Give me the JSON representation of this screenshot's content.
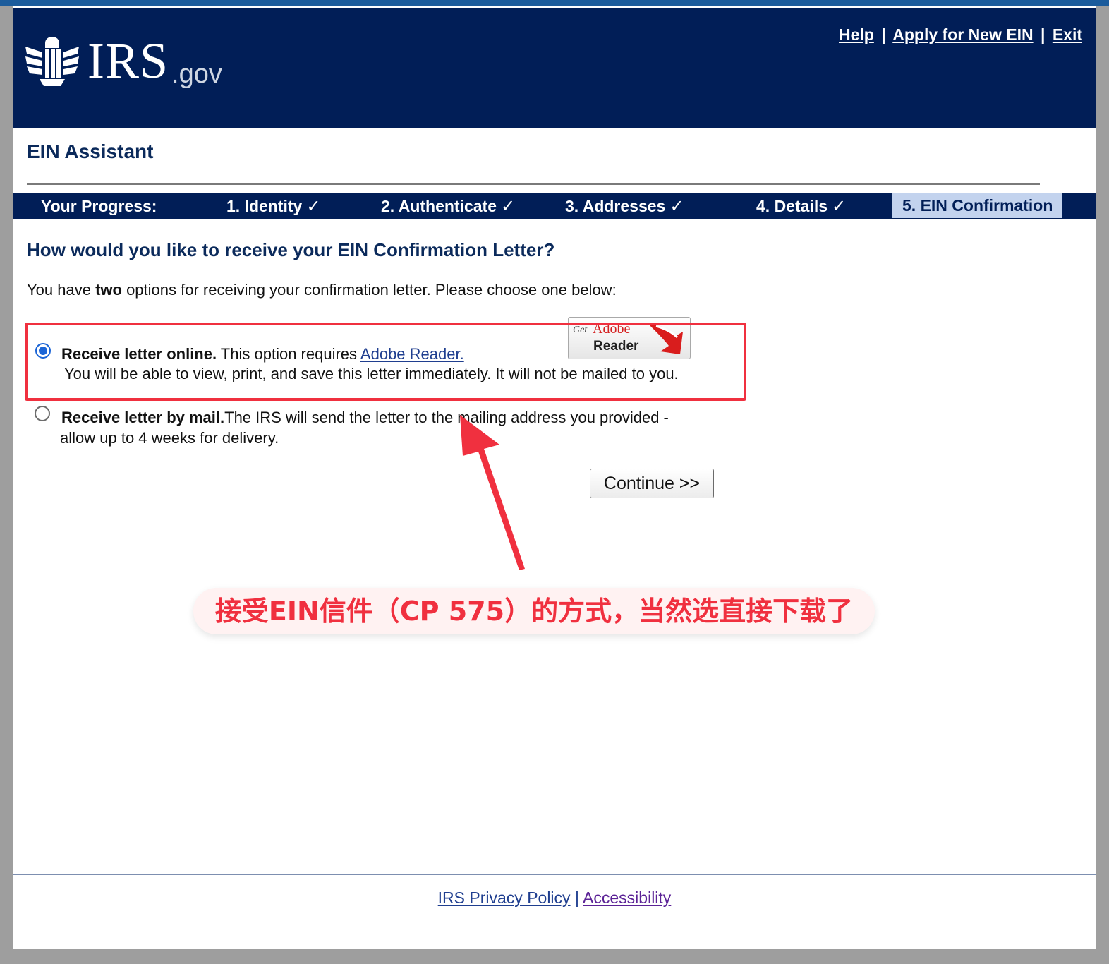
{
  "header": {
    "logo_text": "IRS",
    "logo_suffix": ".gov",
    "links": {
      "help": "Help",
      "apply": "Apply for New EIN",
      "exit": "Exit",
      "separator": "|"
    }
  },
  "app_title": "EIN Assistant",
  "progress": {
    "label": "Your Progress:",
    "check_icon": "✓",
    "steps": [
      {
        "label": "1. Identity",
        "complete": true
      },
      {
        "label": "2. Authenticate",
        "complete": true
      },
      {
        "label": "3. Addresses",
        "complete": true
      },
      {
        "label": "4. Details",
        "complete": true
      },
      {
        "label": "5. EIN Confirmation",
        "current": true
      }
    ]
  },
  "main": {
    "question": "How would you like to receive your EIN Confirmation Letter?",
    "intro_before": "You have ",
    "intro_bold": "two",
    "intro_after": " options for receiving your confirmation letter. Please choose one below:",
    "options": [
      {
        "selected": true,
        "title": "Receive letter online.",
        "text": " This option requires ",
        "link": "Adobe Reader.",
        "line2": "You will be able to view, print, and save this letter immediately. It will not be mailed to you."
      },
      {
        "selected": false,
        "title": "Receive letter by mail.",
        "text": "The IRS will send the letter to the mailing address you provided -",
        "line2": "allow up to 4 weeks for delivery."
      }
    ],
    "adobe_badge": {
      "get": "Get",
      "brand": "Adobe",
      "product": "Reader"
    },
    "continue_label": "Continue >>"
  },
  "annotation": {
    "caption": "接受EIN信件（CP 575）的方式，当然选直接下载了",
    "color": "#f0303f"
  },
  "footer": {
    "privacy": "IRS Privacy Policy",
    "separator": "|",
    "accessibility": "Accessibility"
  },
  "colors": {
    "navy": "#011e57",
    "current_step_bg": "#c3d3ee",
    "heading": "#0b2a5b",
    "link": "#1f3e8f"
  }
}
